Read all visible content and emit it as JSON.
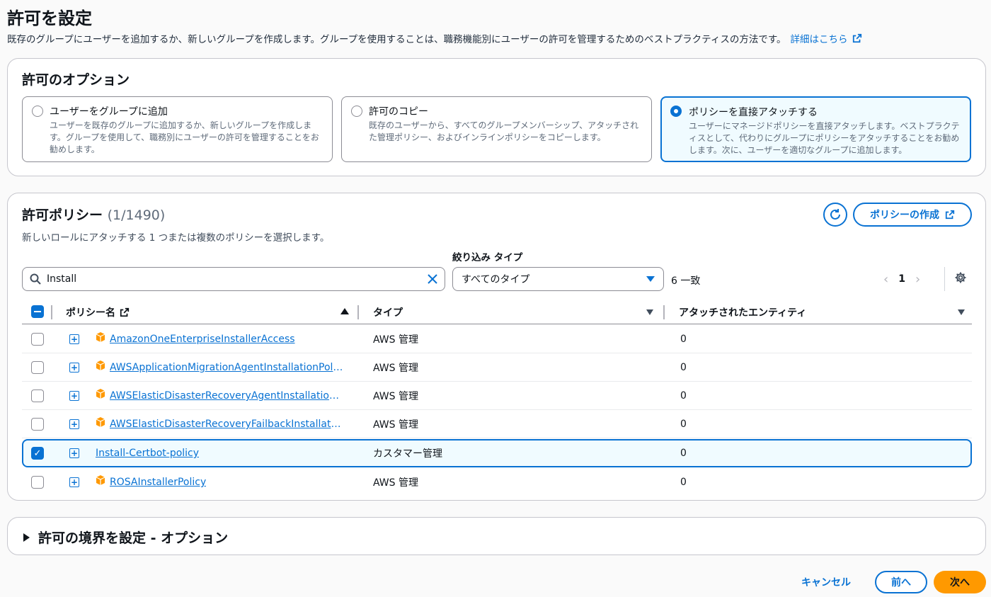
{
  "page": {
    "title": "許可を設定",
    "description": "既存のグループにユーザーを追加するか、新しいグループを作成します。グループを使用することは、職務機能別にユーザーの許可を管理するためのベストプラクティスの方法です。",
    "learn_more": "詳細はこちら"
  },
  "options": {
    "title": "許可のオプション",
    "items": [
      {
        "label": "ユーザーをグループに追加",
        "desc": "ユーザーを既存のグループに追加するか、新しいグループを作成します。グループを使用して、職務別にユーザーの許可を管理することをお勧めします。",
        "selected": false
      },
      {
        "label": "許可のコピー",
        "desc": "既存のユーザーから、すべてのグループメンバーシップ、アタッチされた管理ポリシー、およびインラインポリシーをコピーします。",
        "selected": false
      },
      {
        "label": "ポリシーを直接アタッチする",
        "desc": "ユーザーにマネージドポリシーを直接アタッチします。ベストプラクティスとして、代わりにグループにポリシーをアタッチすることをお勧めします。次に、ユーザーを適切なグループに追加します。",
        "selected": true
      }
    ]
  },
  "policies": {
    "title": "許可ポリシー",
    "count": "(1/1490)",
    "subtitle": "新しいロールにアタッチする 1 つまたは複数のポリシーを選択します。",
    "create_button": "ポリシーの作成",
    "filter_label": "絞り込み タイプ",
    "search_value": "Install",
    "filter_value": "すべてのタイプ",
    "match_text": "6 一致",
    "page_number": "1",
    "columns": {
      "name": "ポリシー名",
      "type": "タイプ",
      "entities": "アタッチされたエンティティ"
    },
    "rows": [
      {
        "name": "AmazonOneEnterpriseInstallerAccess",
        "type": "AWS 管理",
        "entities": "0",
        "checked": false,
        "aws_icon": true
      },
      {
        "name": "AWSApplicationMigrationAgentInstallationPolicy",
        "type": "AWS 管理",
        "entities": "0",
        "checked": false,
        "aws_icon": true
      },
      {
        "name": "AWSElasticDisasterRecoveryAgentInstallationPo...",
        "type": "AWS 管理",
        "entities": "0",
        "checked": false,
        "aws_icon": true
      },
      {
        "name": "AWSElasticDisasterRecoveryFailbackInstallation...",
        "type": "AWS 管理",
        "entities": "0",
        "checked": false,
        "aws_icon": true
      },
      {
        "name": "Install-Certbot-policy",
        "type": "カスタマー管理",
        "entities": "0",
        "checked": true,
        "aws_icon": false
      },
      {
        "name": "ROSAInstallerPolicy",
        "type": "AWS 管理",
        "entities": "0",
        "checked": false,
        "aws_icon": true
      }
    ]
  },
  "boundary": {
    "title": "許可の境界を設定 - オプション"
  },
  "footer": {
    "cancel": "キャンセル",
    "prev": "前へ",
    "next": "次へ"
  },
  "colors": {
    "accent": "#0972d3",
    "primary_button": "#ff9900",
    "aws_icon": "#ff9900"
  }
}
